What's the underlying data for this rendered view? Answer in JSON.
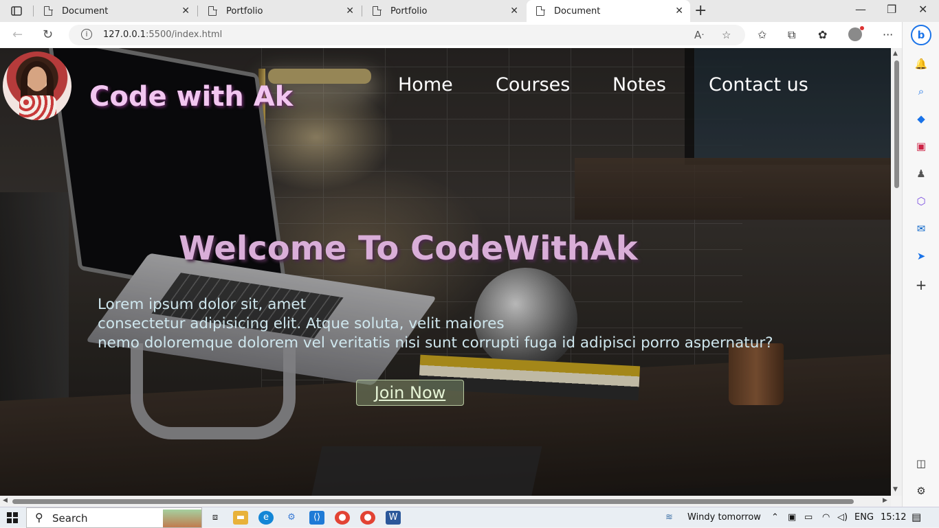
{
  "browser": {
    "tabs": [
      {
        "title": "Document",
        "active": false
      },
      {
        "title": "Portfolio",
        "active": false
      },
      {
        "title": "Portfolio",
        "active": false
      },
      {
        "title": "Document",
        "active": true
      }
    ],
    "url_host": "127.0.0.1",
    "url_rest": ":5500/index.html"
  },
  "page": {
    "brand": "Code with Ak",
    "nav": [
      "Home",
      "Courses",
      "Notes",
      "Contact us"
    ],
    "hero_title": "Welcome To CodeWithAk",
    "hero_lines": [
      "Lorem ipsum dolor sit, amet",
      "consectetur adipisicing elit. Atque soluta, velit maiores",
      "nemo doloremque dolorem vel veritatis nisi sunt corrupti fuga id adipisci porro aspernatur?"
    ],
    "cta": "Join Now"
  },
  "taskbar": {
    "search_label": "Search",
    "weather": "Windy tomorrow",
    "language": "ENG",
    "time": "15:12"
  },
  "colors": {
    "brand": "#f2c6f0",
    "hero_title": "#d9aed8",
    "hero_text": "#cfe7ee",
    "edge_accent": "#1a73e8"
  }
}
